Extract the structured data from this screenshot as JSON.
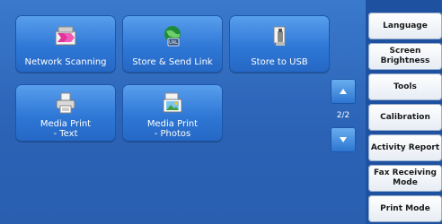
{
  "tiles": [
    {
      "label": "Network Scanning",
      "icon": "network-scanning-icon"
    },
    {
      "label": "Store & Send Link",
      "icon": "store-send-link-icon"
    },
    {
      "label": "Store to USB",
      "icon": "store-to-usb-icon"
    },
    {
      "label": "Media Print\n- Text",
      "icon": "media-print-text-icon"
    },
    {
      "label": "Media Print\n- Photos",
      "icon": "media-print-photos-icon"
    }
  ],
  "pager": {
    "indicator": "2/2",
    "up_icon": "arrow-up-icon",
    "down_icon": "arrow-down-icon"
  },
  "side_menu": [
    {
      "label": "Language"
    },
    {
      "label": "Screen\nBrightness"
    },
    {
      "label": "Tools"
    },
    {
      "label": "Calibration"
    },
    {
      "label": "Activity Report"
    },
    {
      "label": "Fax Receiving\nMode"
    },
    {
      "label": "Print Mode"
    }
  ]
}
